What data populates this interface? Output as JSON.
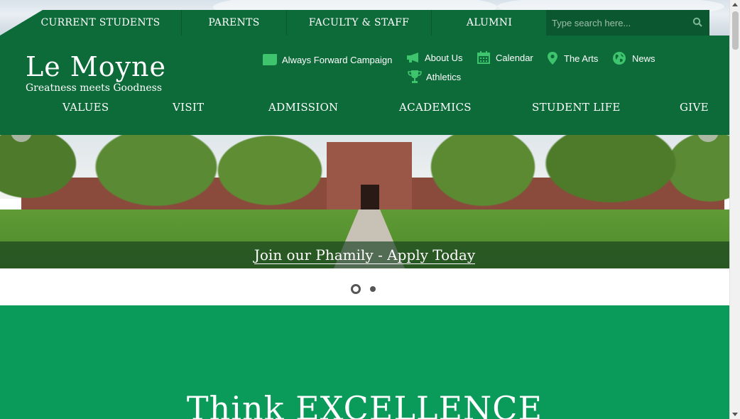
{
  "topnav": {
    "items": [
      "CURRENT STUDENTS",
      "PARENTS",
      "FACULTY & STAFF",
      "ALUMNI"
    ]
  },
  "search": {
    "placeholder": "Type search here...",
    "icon": "search-icon"
  },
  "logo": {
    "name": "Le Moyne",
    "tagline": "Greatness meets Goodness"
  },
  "quick_links": [
    {
      "label": "Always Forward Campaign",
      "icon": "campaign-icon"
    },
    {
      "label": "About Us",
      "icon": "megaphone-icon"
    },
    {
      "label": "Calendar",
      "icon": "calendar-icon"
    },
    {
      "label": "The Arts",
      "icon": "map-pin-icon"
    },
    {
      "label": "News",
      "icon": "globe-icon"
    },
    {
      "label": "Athletics",
      "icon": "trophy-icon"
    }
  ],
  "mainnav": {
    "items": [
      "VALUES",
      "VISIT",
      "ADMISSION",
      "ACADEMICS",
      "STUDENT LIFE",
      "GIVE"
    ]
  },
  "hero": {
    "caption": "Join our Phamily - Apply Today",
    "slides_total": 2,
    "active_slide": 1
  },
  "section": {
    "heading": "Think EXCELLENCE"
  },
  "colors": {
    "header_green": "#0d6b3a",
    "section_green": "#0a9a59",
    "icon_green": "#3ec46d"
  }
}
